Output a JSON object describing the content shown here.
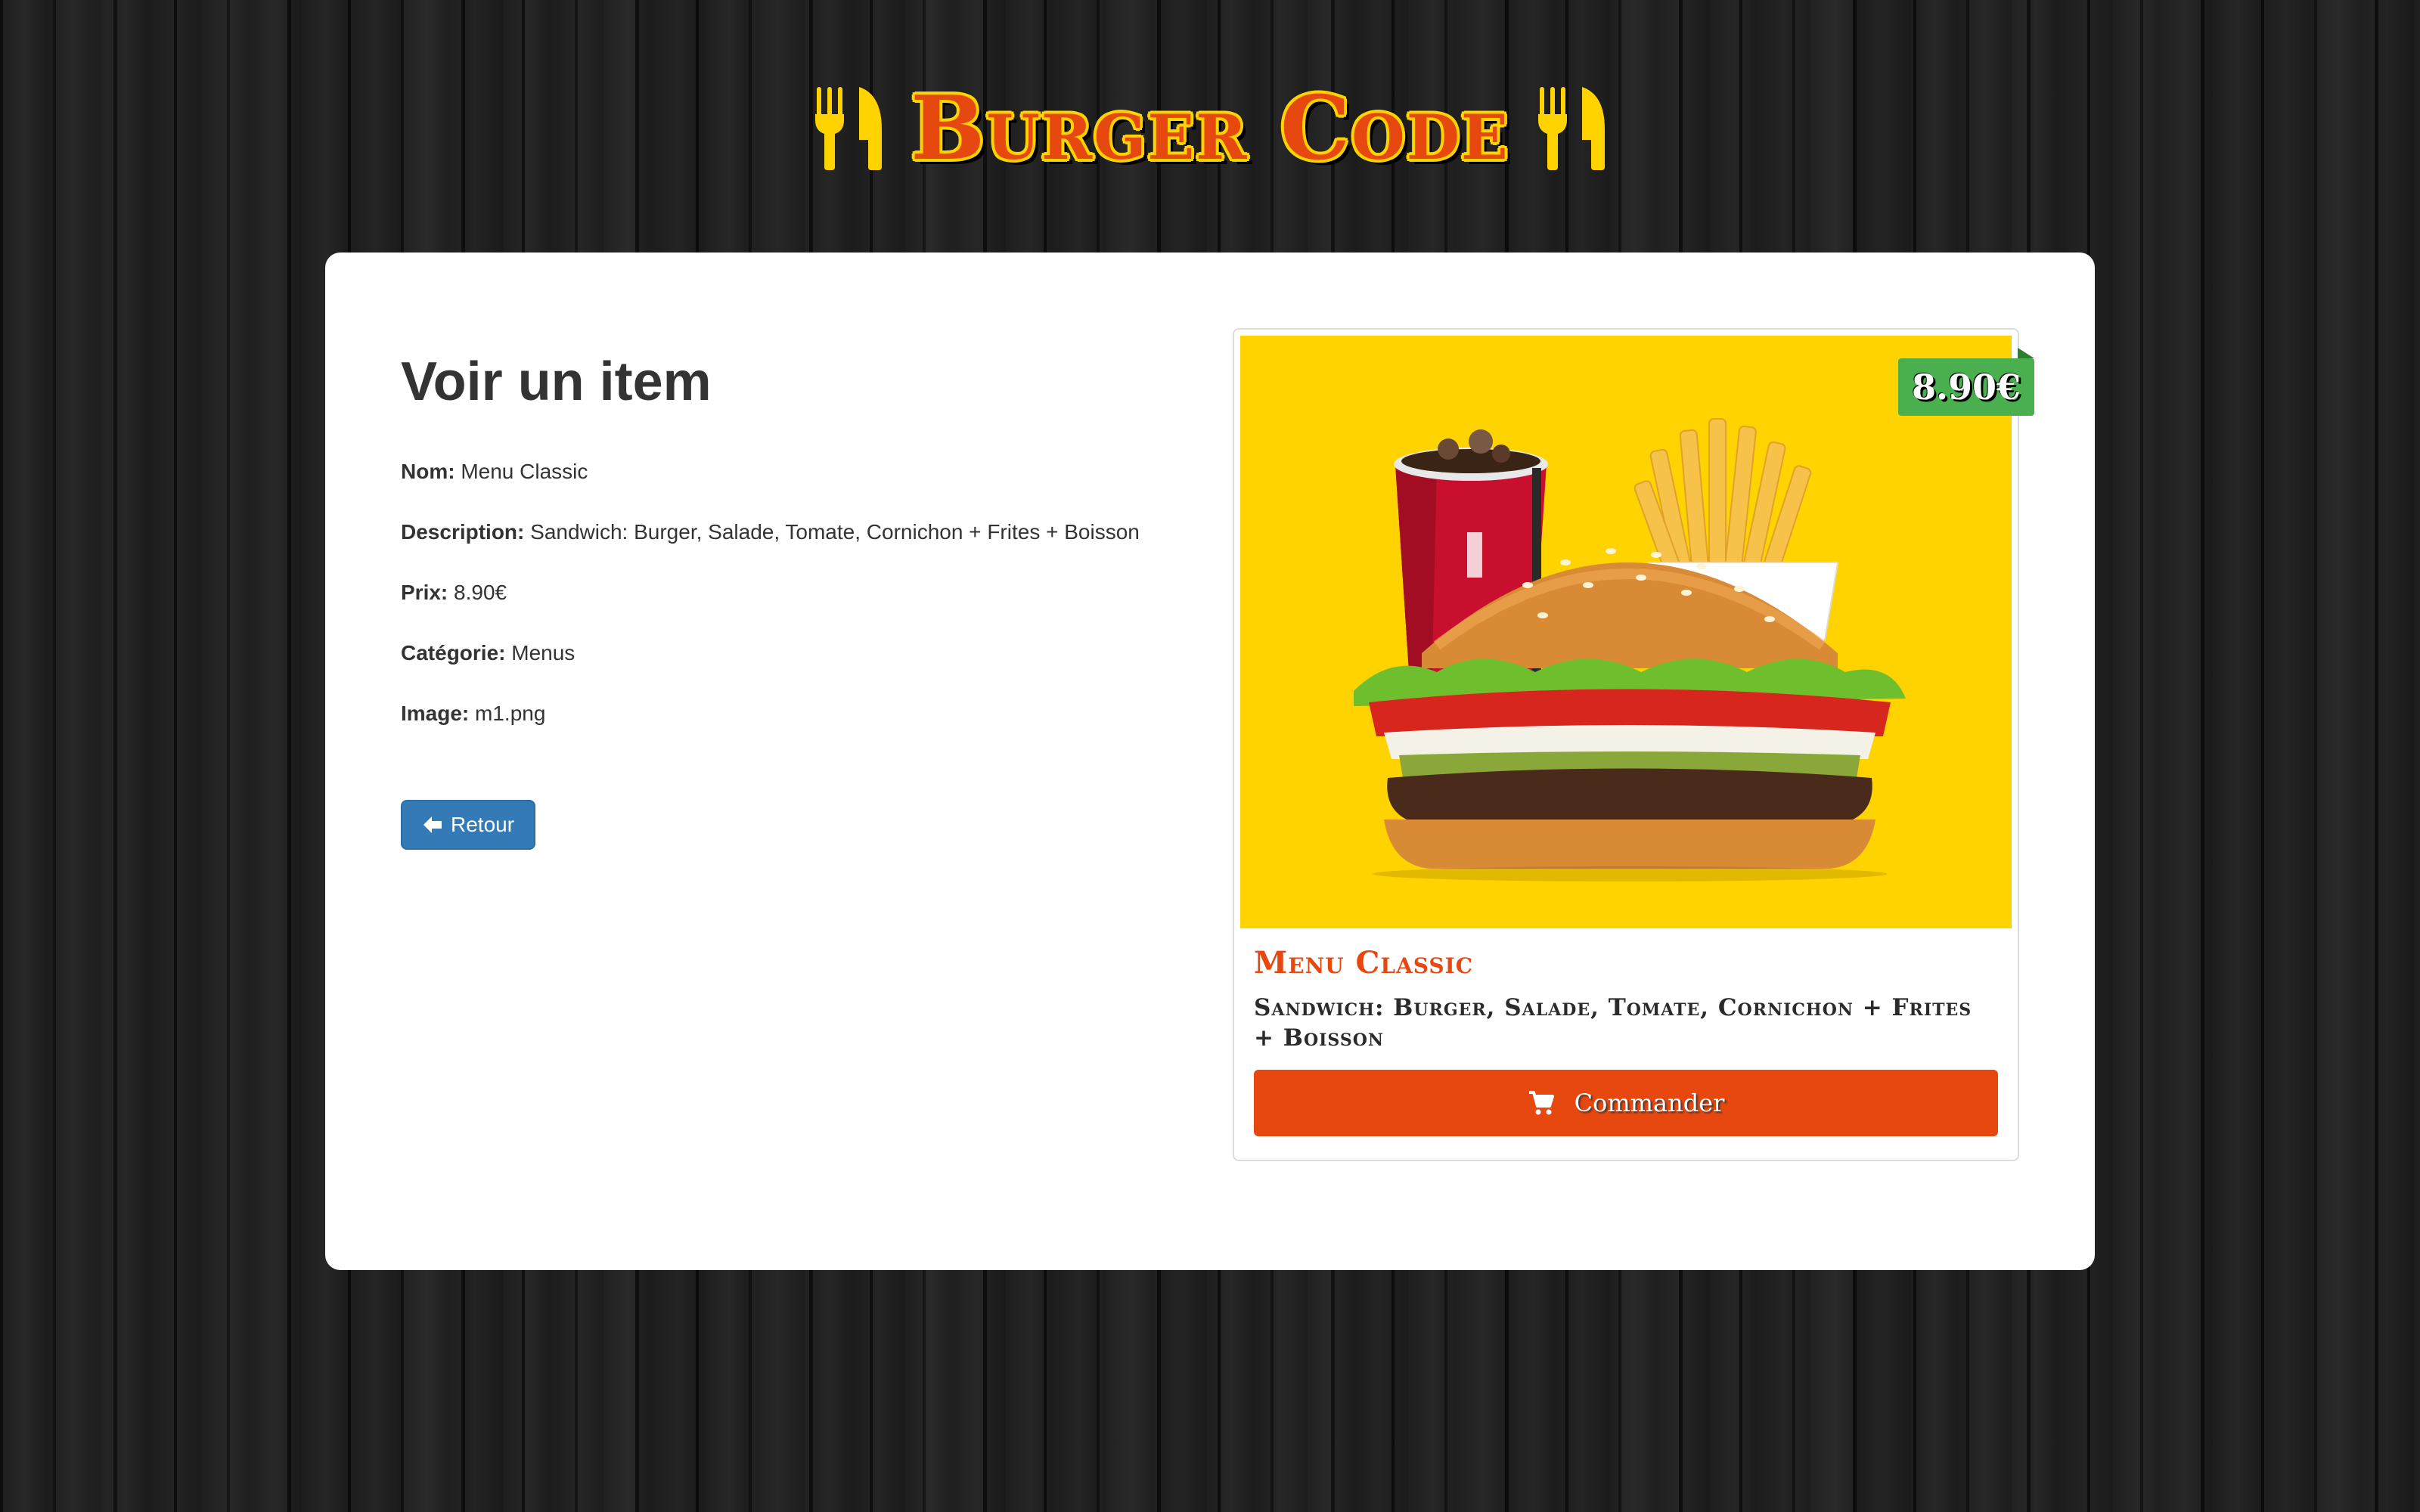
{
  "header": {
    "brand": "Burger Code",
    "left_icon": "utensils-icon",
    "right_icon": "utensils-icon"
  },
  "details": {
    "title": "Voir un item",
    "fields": [
      {
        "label": "Nom:",
        "value": "Menu Classic"
      },
      {
        "label": "Description:",
        "value": "Sandwich: Burger, Salade, Tomate, Cornichon + Frites + Boisson"
      },
      {
        "label": "Prix:",
        "value": "8.90€"
      },
      {
        "label": "Catégorie:",
        "value": "Menus"
      },
      {
        "label": "Image:",
        "value": "m1.png"
      }
    ],
    "back_button": {
      "label": "Retour",
      "icon": "arrow-left-icon"
    }
  },
  "card": {
    "price": "8.90€",
    "name": "Menu Classic",
    "description": "Sandwich: Burger, Salade, Tomate, Cornichon + Frites + Boisson",
    "order_button": {
      "label": "Commander",
      "icon": "shopping-cart-icon"
    }
  },
  "colors": {
    "brand_orange": "#e7480f",
    "brand_yellow": "#ffd300",
    "price_green": "#4aaf4e",
    "back_blue": "#337ab7"
  }
}
